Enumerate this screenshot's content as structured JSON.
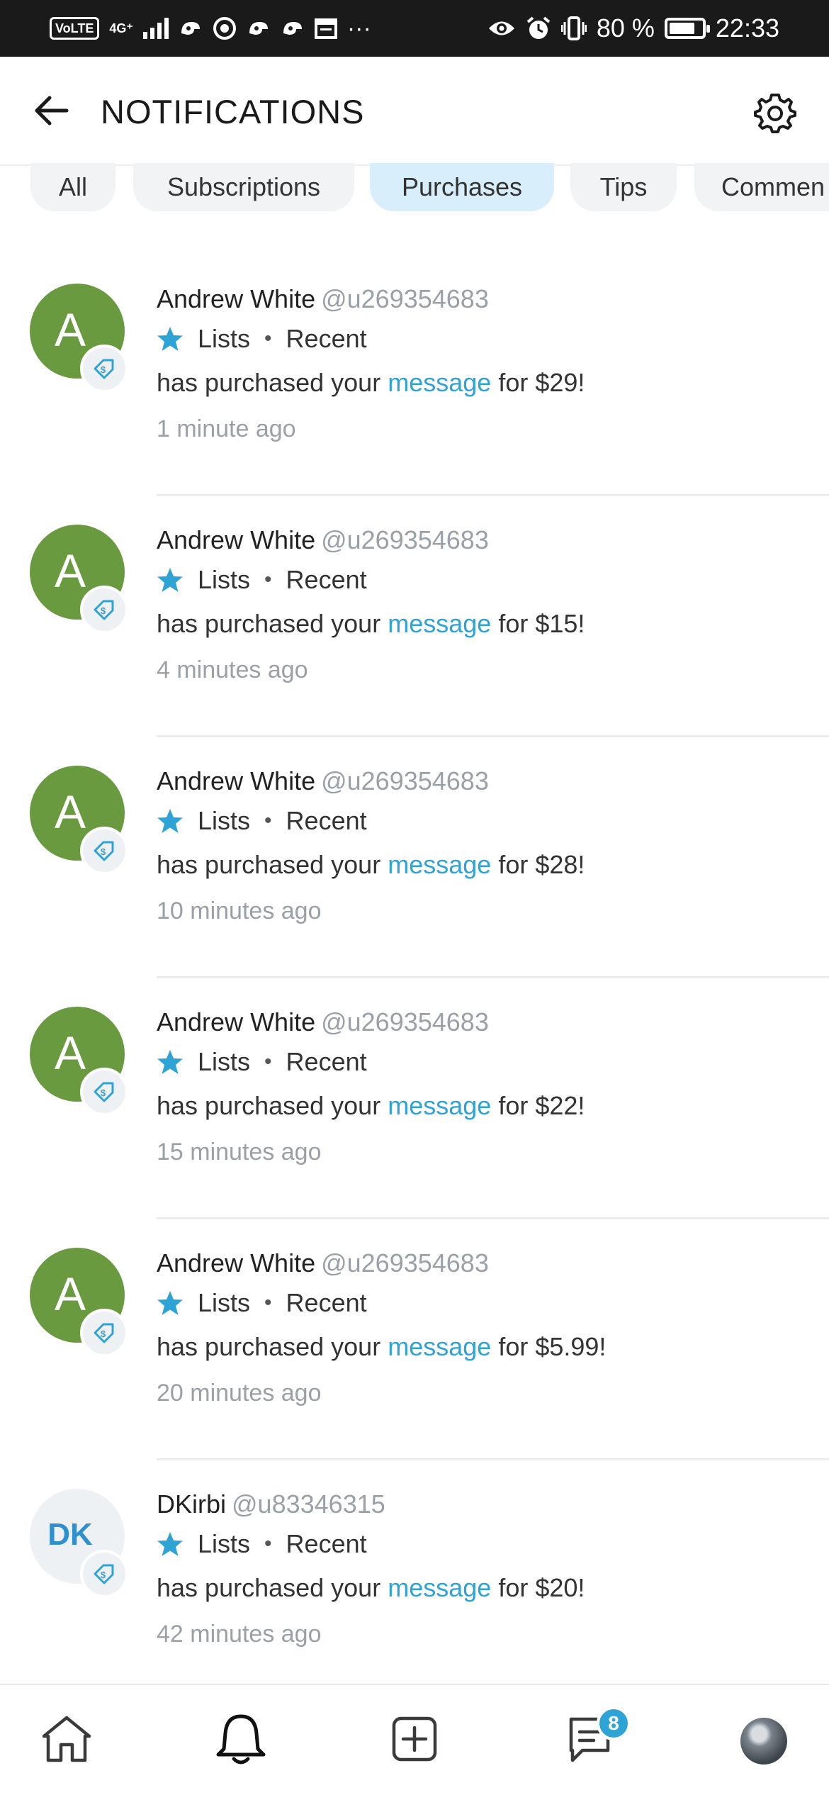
{
  "status_bar": {
    "volte": "VoLTE",
    "network": "4G⁺",
    "more": "···",
    "battery_text": "80 %",
    "battery_level": 0.8,
    "time": "22:33"
  },
  "header": {
    "title": "NOTIFICATIONS",
    "back_icon": "arrow-left-icon",
    "settings_icon": "gear-icon"
  },
  "filters": [
    {
      "label": "All",
      "active": false
    },
    {
      "label": "Subscriptions",
      "active": false
    },
    {
      "label": "Purchases",
      "active": true
    },
    {
      "label": "Tips",
      "active": false
    },
    {
      "label": "Commen",
      "active": false
    }
  ],
  "notifications": [
    {
      "initials": "A",
      "name": "Andrew White",
      "handle": "@u269354683",
      "lists": "Lists",
      "sep": "•",
      "recent": "Recent",
      "text_before": "has purchased your",
      "link": "message",
      "text_after": "for $29!",
      "time": "1 minute ago"
    },
    {
      "initials": "A",
      "name": "Andrew White",
      "handle": "@u269354683",
      "lists": "Lists",
      "sep": "•",
      "recent": "Recent",
      "text_before": "has purchased your",
      "link": "message",
      "text_after": "for $15!",
      "time": "4 minutes ago"
    },
    {
      "initials": "A",
      "name": "Andrew White",
      "handle": "@u269354683",
      "lists": "Lists",
      "sep": "•",
      "recent": "Recent",
      "text_before": "has purchased your",
      "link": "message",
      "text_after": "for $28!",
      "time": "10 minutes ago"
    },
    {
      "initials": "A",
      "name": "Andrew White",
      "handle": "@u269354683",
      "lists": "Lists",
      "sep": "•",
      "recent": "Recent",
      "text_before": "has purchased your",
      "link": "message",
      "text_after": "for $22!",
      "time": "15 minutes ago"
    },
    {
      "initials": "A",
      "name": "Andrew White",
      "handle": "@u269354683",
      "lists": "Lists",
      "sep": "•",
      "recent": "Recent",
      "text_before": "has purchased your",
      "link": "message",
      "text_after": "for $5.99!",
      "time": "20 minutes ago"
    },
    {
      "initials": "DK",
      "name": "DKirbi",
      "handle": "@u83346315",
      "lists": "Lists",
      "sep": "•",
      "recent": "Recent",
      "text_before": "has purchased your",
      "link": "message",
      "text_after": "for $20!",
      "time": "42 minutes ago"
    }
  ],
  "bottom_nav": {
    "messages_badge": "8",
    "icons": [
      "home-icon",
      "bell-icon",
      "add-post-icon",
      "messages-icon",
      "profile-avatar"
    ]
  },
  "colors": {
    "accent": "#2ea3d6",
    "avatar_green": "#6a9a3f",
    "chip_active": "#d8eefa",
    "chip_inactive": "#f1f3f5",
    "muted": "#9aa0a6"
  }
}
